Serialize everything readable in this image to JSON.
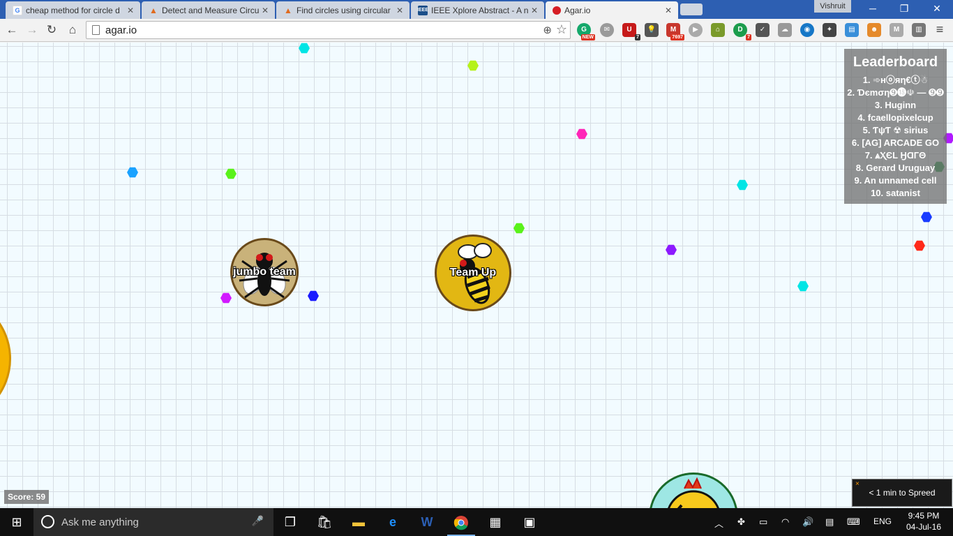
{
  "browser": {
    "tabs": [
      {
        "title": "cheap method for circle d",
        "favicon": "google-icon",
        "color": "#4285f4"
      },
      {
        "title": "Detect and Measure Circu",
        "favicon": "matlab-icon",
        "color": "#e06b1f"
      },
      {
        "title": "Find circles using circular",
        "favicon": "matlab-icon",
        "color": "#e06b1f"
      },
      {
        "title": "IEEE Xplore Abstract - A n",
        "favicon": "ieee-icon",
        "color": "#1b4f8a"
      },
      {
        "title": "Agar.io",
        "favicon": "agar-icon",
        "color": "#d61e24"
      }
    ],
    "active_tab": 4,
    "profile_name": "Vishruit",
    "url": "agar.io",
    "extension_badges": {
      "new": "NEW",
      "seven_a": "7",
      "mail_count": "7697",
      "seven_b": "7"
    }
  },
  "game": {
    "leaderboard": {
      "title": "Leaderboard",
      "entries": [
        "1. ➾ʜⓞяη€ⓣ☃",
        "2. Ɗєmση➒⓲☫ — ➒➒",
        "3. Huginn",
        "4. fcaellopixelcup",
        "5. ƬψƬ ☢ sirius",
        "6. [AG] ARCADE GO",
        "7. ⩓ⲬЄL ӇⱭГΘ",
        "8. Gerard Uruguay",
        "9. An unnamed cell",
        "10. satanist"
      ]
    },
    "cells": [
      {
        "name": "jumbo team",
        "color": "#c9b27a",
        "skin": "fly"
      },
      {
        "name": "Team Up",
        "color": "#e2b713",
        "skin": "bee"
      }
    ],
    "score_label": "Score: 59",
    "notification": {
      "text": "< 1 min to Spreed",
      "close": "×"
    },
    "pellet_colors": [
      "#00e5e5",
      "#b5f21a",
      "#ff26b8",
      "#1aa2ff",
      "#5af21a",
      "#8c1aff",
      "#1a3cff",
      "#ff2a1a",
      "#22a44a"
    ]
  },
  "taskbar": {
    "search_placeholder": "Ask me anything",
    "language": "ENG",
    "time": "9:45 PM",
    "date": "04-Jul-16"
  }
}
